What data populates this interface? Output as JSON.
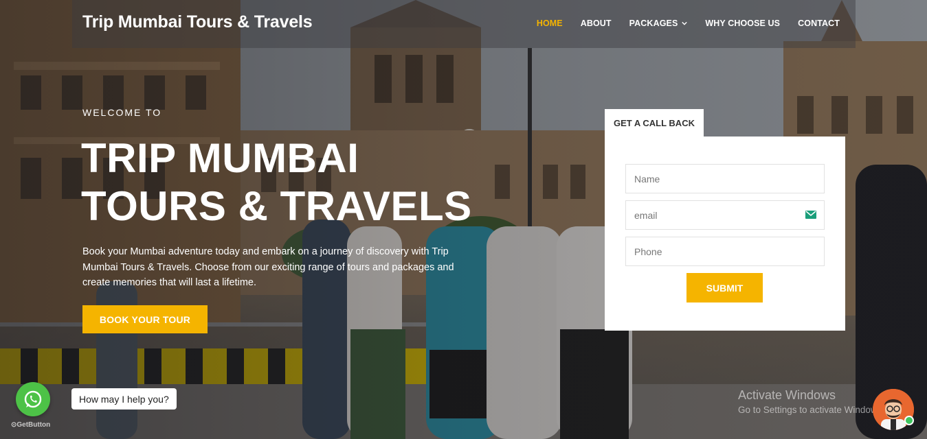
{
  "header": {
    "brand": "Trip Mumbai Tours & Travels",
    "nav": [
      {
        "label": "HOME",
        "active": true
      },
      {
        "label": "ABOUT",
        "active": false
      },
      {
        "label": "PACKAGES",
        "active": false,
        "dropdown": true
      },
      {
        "label": "WHY CHOOSE US",
        "active": false
      },
      {
        "label": "CONTACT",
        "active": false
      }
    ]
  },
  "hero": {
    "welcome": "WELCOME TO",
    "title_line1": "TRIP MUMBAI",
    "title_line2": "TOURS & TRAVELS",
    "description": "Book your Mumbai adventure today and embark on a journey of discovery with Trip Mumbai Tours & Travels. Choose from our exciting range of tours and packages and create memories that will last a lifetime.",
    "cta_label": "BOOK YOUR TOUR"
  },
  "callback_form": {
    "tab_label": "GET A CALL BACK",
    "name_placeholder": "Name",
    "email_placeholder": "email",
    "phone_placeholder": "Phone",
    "submit_label": "SUBMIT"
  },
  "whatsapp": {
    "bubble_text": "How may I help you?",
    "brand_text": "GetButton"
  },
  "windows_watermark": {
    "title": "Activate Windows",
    "subtitle": "Go to Settings to activate Windows."
  },
  "colors": {
    "accent": "#f5b400",
    "whatsapp": "#4dc247",
    "online": "#3ec55e"
  },
  "icons": [
    "chevron-down-icon",
    "mail-icon",
    "whatsapp-icon",
    "chat-avatar-icon"
  ]
}
